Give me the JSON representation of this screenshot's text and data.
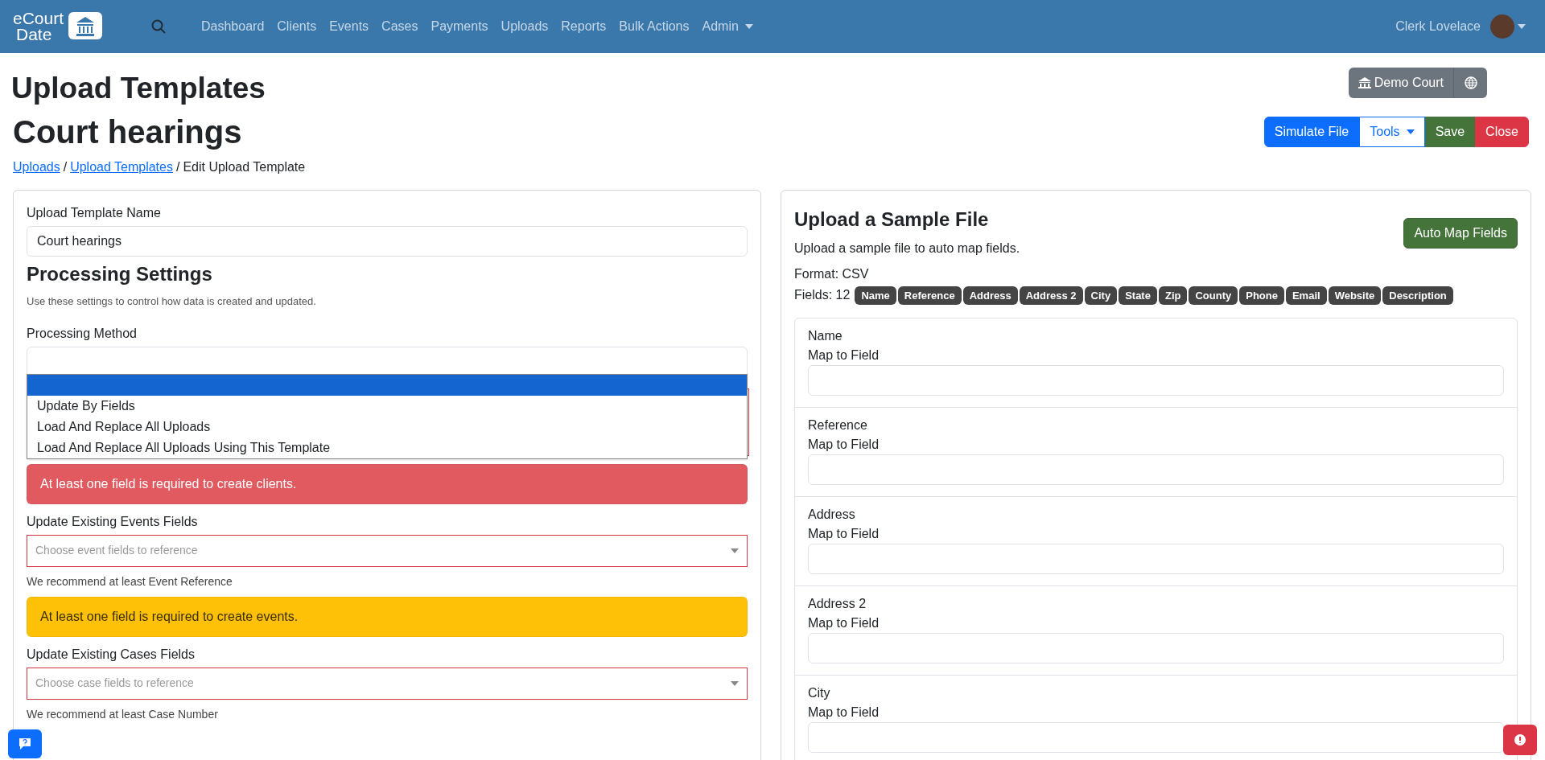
{
  "navbar": {
    "logo": {
      "line1": "eCourt",
      "line2": "Date"
    },
    "links": [
      {
        "label": "Dashboard",
        "dropdown": false
      },
      {
        "label": "Clients",
        "dropdown": false
      },
      {
        "label": "Events",
        "dropdown": false
      },
      {
        "label": "Cases",
        "dropdown": false
      },
      {
        "label": "Payments",
        "dropdown": false
      },
      {
        "label": "Uploads",
        "dropdown": false
      },
      {
        "label": "Reports",
        "dropdown": false
      },
      {
        "label": "Bulk Actions",
        "dropdown": false
      },
      {
        "label": "Admin",
        "dropdown": true
      }
    ],
    "user": "Clerk Lovelace"
  },
  "page_title": "Upload Templates",
  "court_buttons": {
    "court": "Demo Court"
  },
  "template_title": "Court hearings",
  "actions": [
    {
      "label": "Simulate File",
      "kind": "primary"
    },
    {
      "label": "Tools",
      "kind": "outline"
    },
    {
      "label": "Save",
      "kind": "success"
    },
    {
      "label": "Close",
      "kind": "danger"
    }
  ],
  "breadcrumb_separator": "/",
  "breadcrumb": [
    {
      "label": "Uploads",
      "link": true
    },
    {
      "label": "Upload Templates",
      "link": true
    },
    {
      "label": "Edit Upload Template",
      "link": false
    }
  ],
  "settings": {
    "name_label": "Upload Template Name",
    "name_value": "Court hearings",
    "heading": "Processing Settings",
    "description": "Use these settings to control how data is created and updated.",
    "method_label": "Processing Method",
    "method_options": [
      {
        "selected": true
      },
      {
        "label": "Update By Fields",
        "selected": false
      },
      {
        "label": "Load And Replace All Uploads",
        "selected": false
      },
      {
        "label": "Load And Replace All Uploads Using This Template",
        "selected": false
      }
    ],
    "sections": [
      {
        "kind": "alert",
        "color": "#e05a60",
        "text": "At least one field is required to create clients."
      },
      {
        "kind": "select",
        "label": "Update Existing Events Fields",
        "placeholder": "Choose event fields to reference",
        "hint": "We recommend at least Event Reference"
      },
      {
        "kind": "alert",
        "color": "#ffc107",
        "text": "At least one field is required to create events."
      },
      {
        "kind": "select",
        "label": "Update Existing Cases Fields",
        "placeholder": "Choose case fields to reference",
        "hint": "We recommend at least Case Number"
      }
    ]
  },
  "sample": {
    "heading": "Upload a Sample File",
    "description": "Upload a sample file to auto map fields.",
    "button": "Auto Map Fields",
    "format": "Format: CSV",
    "fields_label": "Fields: 12",
    "fields": [
      "Name",
      "Reference",
      "Address",
      "Address 2",
      "City",
      "State",
      "Zip",
      "County",
      "Phone",
      "Email",
      "Website",
      "Description"
    ],
    "mappings": [
      {
        "name": "Name",
        "label": "Map to Field"
      },
      {
        "name": "Reference",
        "label": "Map to Field"
      },
      {
        "name": "Address",
        "label": "Map to Field"
      },
      {
        "name": "Address 2",
        "label": "Map to Field"
      },
      {
        "name": "City",
        "label": "Map to Field"
      }
    ]
  }
}
